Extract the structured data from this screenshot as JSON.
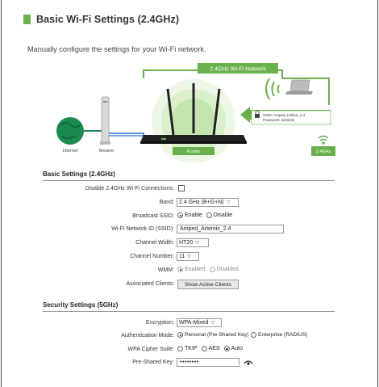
{
  "page": {
    "title": "Basic Wi-Fi Settings (2.4GHz)",
    "subtitle": "Manually configure the settings for your Wi-Fi network."
  },
  "diagram": {
    "network_banner": "2.4GHz Wi-Fi Network",
    "internet_label": "Internet",
    "modem_label": "Modem",
    "router_label": "Router",
    "ssid_line": "SSID: Amped_Hefios_2.4",
    "password_line": "Password: wireless",
    "band_badge": "2.4GHz",
    "colors": {
      "accent_green": "#6ab04c",
      "globe_green": "#1a8a4e",
      "router_dark": "#222222"
    }
  },
  "basic_settings": {
    "section_title": "Basic Settings (2.4GHz)",
    "disable_label": "Disable 2.4GHz Wi-Fi Connections:",
    "disable_checked": false,
    "band_label": "Band:",
    "band_value": "2.4 GHz (B+G+N)",
    "broadcast_label": "Broadcast SSID:",
    "broadcast_enable": "Enable",
    "broadcast_disable": "Disable",
    "ssid_label": "Wi-Fi Network ID (SSID):",
    "ssid_value": "Amped_Artemis_2.4",
    "channel_width_label": "Channel Width:",
    "channel_width_value": "HT20",
    "channel_number_label": "Channel Number:",
    "channel_number_value": "11",
    "wmm_label": "WMM:",
    "wmm_enabled": "Enabled",
    "wmm_disabled": "Disabled",
    "clients_label": "Associated Clients:",
    "clients_button": "Show Active Clients"
  },
  "security_settings": {
    "section_title": "Security Settings (5GHz)",
    "encryption_label": "Encryption:",
    "encryption_value": "WPA-Mixed",
    "auth_label": "Authentication Mode:",
    "auth_personal": "Personal (Pre-Shared Key)",
    "auth_enterprise": "Enterprise (RADIUS)",
    "cipher_label": "WPA Cipher Suite:",
    "cipher_tkip": "TKIP",
    "cipher_aes": "AES",
    "cipher_auto": "Auto",
    "psk_label": "Pre-Shared Key:",
    "psk_value": "••••••••",
    "eye_icon": "eye-icon"
  }
}
